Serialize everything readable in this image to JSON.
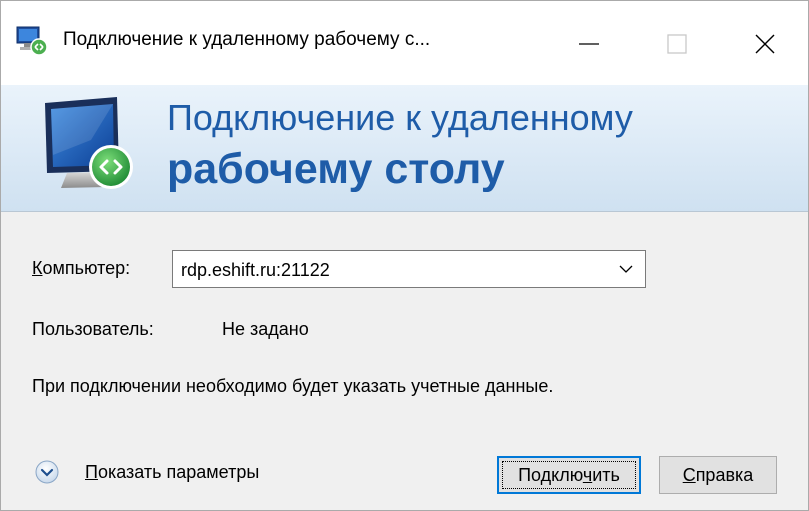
{
  "window": {
    "title": "Подключение к удаленному рабочему с...",
    "minimize_icon": "minimize-icon",
    "maximize_icon": "maximize-icon",
    "close_icon": "close-icon"
  },
  "banner": {
    "line1": "Подключение к удаленному",
    "line2": "рабочему столу"
  },
  "form": {
    "computer_label_accel": "К",
    "computer_label_rest": "омпьютер:",
    "computer_value": "rdp.eshift.ru:21122",
    "user_label": "Пользователь:",
    "user_value": "Не задано",
    "info": "При подключении необходимо будет указать учетные данные."
  },
  "footer": {
    "show_options_accel": "П",
    "show_options_rest": "оказать параметры",
    "connect_pre": "Подклю",
    "connect_accel": "ч",
    "connect_post": "ить",
    "help_accel": "С",
    "help_rest": "правка"
  },
  "colors": {
    "banner_text": "#1e5ca8",
    "focus_border": "#0078d7",
    "dialog_bg": "#f0f0f0"
  }
}
